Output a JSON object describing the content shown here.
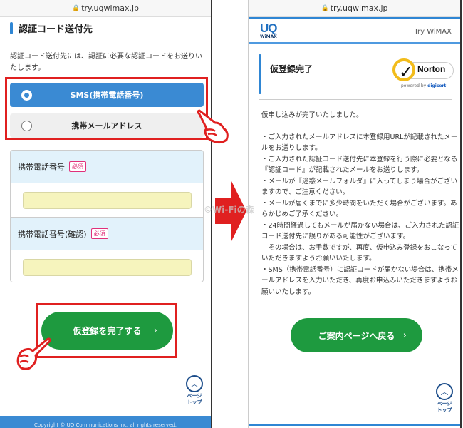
{
  "left_screen": {
    "url": "try.uqwimax.jp",
    "section_title": "認証コード送付先",
    "description": "認証コード送付先には、認証に必要な認証コードをお送りいたします。",
    "radio_options": [
      {
        "label": "SMS(携帯電話番号)",
        "selected": true
      },
      {
        "label": "携帯メールアドレス",
        "selected": false
      }
    ],
    "fields": [
      {
        "label": "携帯電話番号",
        "required_badge": "必須",
        "value": ""
      },
      {
        "label": "携帯電話番号(確認)",
        "required_badge": "必須",
        "value": ""
      }
    ],
    "submit_button": "仮登録を完了する",
    "chevron": "›",
    "page_top": {
      "line1": "ページ",
      "line2": "トップ"
    },
    "footer": "Copyright © UQ Communications Inc. all rights reserved."
  },
  "right_screen": {
    "url": "try.uqwimax.jp",
    "logo": {
      "uq": "UQ",
      "wimax": "WiMAX"
    },
    "header_link": "Try WiMAX",
    "title": "仮登録完了",
    "norton": {
      "word": "Norton",
      "powered": "powered by",
      "brand": "digicert"
    },
    "paragraphs": [
      "仮申し込みが完了いたしました。",
      "",
      "・ご入力されたメールアドレスに本登録用URLが記載されたメールをお送りします。",
      "・ご入力された認証コード送付先に本登録を行う際に必要となる『認証コード』が記載されたメールをお送りします。",
      "・メールが『迷惑メールフォルダ』に入ってしまう場合がございますので、ご注意ください。",
      "・メールが届くまでに多少時間をいただく場合がございます。あらかじめご了承ください。",
      "・24時間経過してもメールが届かない場合は、ご入力された認証コード送付先に誤りがある可能性がございます。",
      "　その場合は、お手数ですが、再度、仮申込み登録をおこなっていただきますようお願いいたします。",
      "・SMS（携帯電話番号）に認証コードが届かない場合は、携帯メールアドレスを入力いただき、再度お申込みいただきますようお願いいたします。"
    ],
    "back_button": "ご案内ページへ戻る",
    "chevron": "›",
    "page_top": {
      "line1": "ページ",
      "line2": "トップ"
    }
  },
  "watermark": "©Wi-Fiの森",
  "colors": {
    "accent_blue": "#3a8ad3",
    "green": "#1e9a3f",
    "annotation_red": "#e02020",
    "required_pink": "#e0307a"
  }
}
